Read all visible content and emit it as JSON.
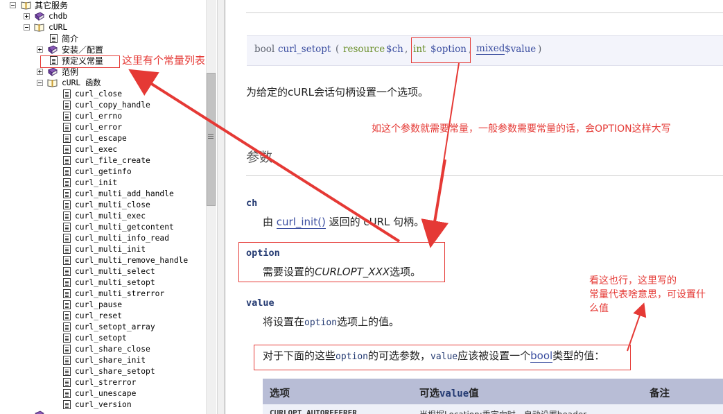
{
  "tree": {
    "root_label": "其它服务",
    "chdb_label": "chdb",
    "curl_label": "cURL",
    "intro_label": "简介",
    "setup_label": "安装／配置",
    "constants_label": "预定义常量",
    "examples_label": "范例",
    "functions_label": "cURL 函数",
    "functions": [
      "curl_close",
      "curl_copy_handle",
      "curl_errno",
      "curl_error",
      "curl_escape",
      "curl_exec",
      "curl_file_create",
      "curl_getinfo",
      "curl_init",
      "curl_multi_add_handle",
      "curl_multi_close",
      "curl_multi_exec",
      "curl_multi_getcontent",
      "curl_multi_info_read",
      "curl_multi_init",
      "curl_multi_remove_handle",
      "curl_multi_select",
      "curl_multi_setopt",
      "curl_multi_strerror",
      "curl_pause",
      "curl_reset",
      "curl_setopt_array",
      "curl_setopt",
      "curl_share_close",
      "curl_share_init",
      "curl_share_setopt",
      "curl_strerror",
      "curl_unescape",
      "curl_version"
    ]
  },
  "prototype": {
    "return_type": "bool",
    "function_name": "curl_setopt",
    "open_paren": "(",
    "param1_type": "resource",
    "param1_name": "$ch",
    "comma1": ",",
    "param2_type": "int",
    "param2_name": "$option",
    "comma2": ",",
    "param3_type": "mixed",
    "param3_name": "$value",
    "close_paren": ")"
  },
  "description": "为给定的cURL会话句柄设置一个选项。",
  "params_heading": "参数",
  "params": {
    "ch": {
      "name": "ch",
      "text_prefix": "由",
      "link": "curl_init()",
      "text_suffix": "返回的 cURL 句柄。"
    },
    "option": {
      "name": "option",
      "text_prefix": "需要设置的",
      "const": "CURLOPT_XXX",
      "text_suffix": "选项。"
    },
    "value": {
      "name": "value",
      "text_prefix": "将设置在",
      "code": "option",
      "text_suffix": "选项上的值。"
    }
  },
  "bool_note": {
    "prefix": "对于下面的这些",
    "code1": "option",
    "middle1": "的可选参数，",
    "code2": "value",
    "middle2": "应该被设置一个",
    "link": "bool",
    "suffix": "类型的值："
  },
  "table": {
    "col1": "选项",
    "col2_prefix": "可选",
    "col2_code": "value",
    "col2_suffix": "值",
    "col3": "备注",
    "row1_col1": "CURLOPT_AUTOREFERER",
    "row1_col2": "当根据Location:重定向时，自动设置header"
  },
  "annotations": {
    "constants_note": "这里有个常量列表",
    "option_note": "如这个参数就需要常量，一般参数需要常量的话，会OPTION这样大写",
    "value_note_line1": "看这也行，这里写的",
    "value_note_line2": "常量代表啥意思，可设置什",
    "value_note_line3": "么值",
    "color": "#e53935"
  }
}
